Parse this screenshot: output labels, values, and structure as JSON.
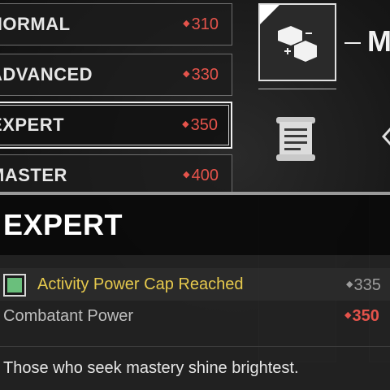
{
  "difficulties": [
    {
      "name": "NORMAL",
      "power": "310",
      "selected": false
    },
    {
      "name": "ADVANCED",
      "power": "330",
      "selected": false
    },
    {
      "name": "EXPERT",
      "power": "350",
      "selected": true
    },
    {
      "name": "MASTER",
      "power": "400",
      "selected": false
    }
  ],
  "header": {
    "title_partial": "M"
  },
  "tooltip": {
    "title": "EXPERT",
    "cap_label": "Activity Power Cap Reached",
    "cap_value": "335",
    "combatant_label": "Combatant Power",
    "combatant_value": "350",
    "flavor": "Those who seek mastery shine brightest."
  },
  "colors": {
    "power_red": "#e5534b",
    "cap_yellow": "#e6c94d",
    "check_green": "#6abf7c"
  },
  "icons": [
    "modifier-icon",
    "lore-scroll-icon",
    "chevron-left-icon",
    "power-diamond-icon"
  ]
}
